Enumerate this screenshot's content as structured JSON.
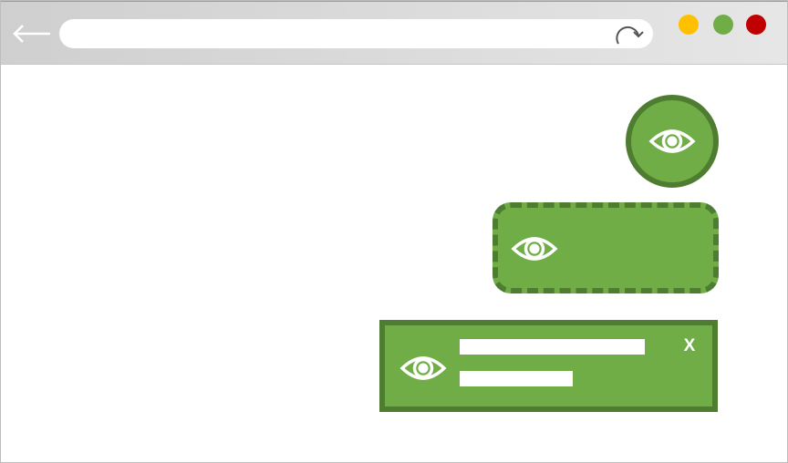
{
  "browser": {
    "address_bar": {
      "value": "",
      "placeholder": ""
    },
    "icons": {
      "back": "arrow-left-icon",
      "reload": "reload-icon"
    },
    "window_controls": [
      {
        "name": "minimize",
        "color": "#FFC000"
      },
      {
        "name": "maximize",
        "color": "#70AD47"
      },
      {
        "name": "close",
        "color": "#C00000"
      }
    ]
  },
  "widgets": {
    "palette": {
      "fill": "#70AD47",
      "border": "#4E7D32",
      "icon": "#FFFFFF"
    },
    "eye_circle": {
      "icon": "eye-icon"
    },
    "eye_dashed_card": {
      "icon": "eye-icon",
      "border_style": "dashed"
    },
    "notification": {
      "icon": "eye-icon",
      "line_1": "",
      "line_2": "",
      "close_label": "X"
    }
  }
}
